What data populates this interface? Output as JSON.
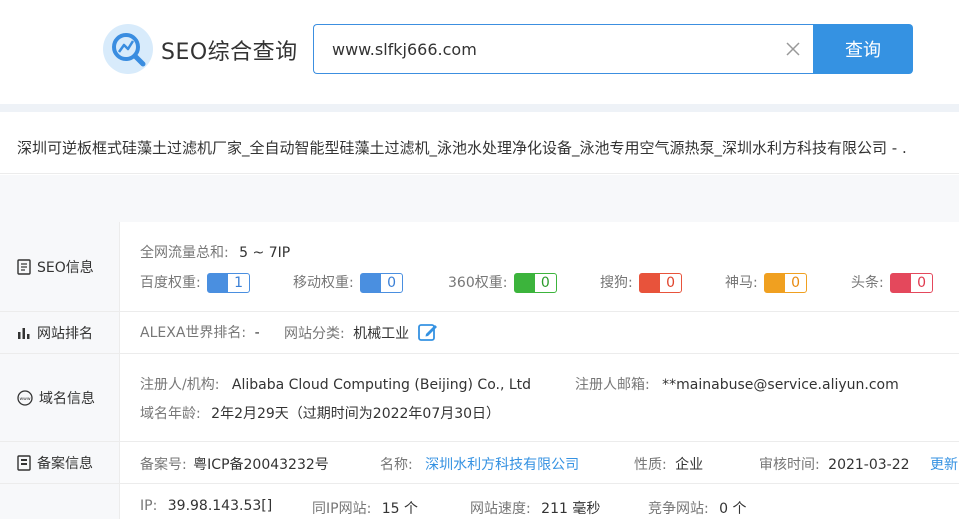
{
  "header": {
    "brand": "SEO综合查询",
    "search_value": "www.slfkj666.com",
    "search_button": "查询"
  },
  "title": "深圳可逆板框式硅藻土过滤机厂家_全自动智能型硅藻土过滤机_泳池水处理净化设备_泳池专用空气源热泵_深圳水利方科技有限公司 - .",
  "seo": {
    "label": "SEO信息",
    "traffic_label": "全网流量总和:",
    "traffic_value": "5 ~ 7IP",
    "weights": [
      {
        "label": "百度权重:",
        "value": "1",
        "icon": "baidu-paw-icon",
        "color": "#4a8fe0"
      },
      {
        "label": "移动权重:",
        "value": "0",
        "icon": "mobile-paw-icon",
        "color": "#4a8fe0"
      },
      {
        "label": "360权重:",
        "value": "0",
        "icon": "360-logo-icon",
        "color": "#3cb43c"
      },
      {
        "label": "搜狗:",
        "value": "0",
        "icon": "sogou-logo-icon",
        "color": "#e8533b"
      },
      {
        "label": "神马:",
        "value": "0",
        "icon": "shenma-logo-icon",
        "color": "#f0a020"
      },
      {
        "label": "头条:",
        "value": "0",
        "icon": "toutiao-logo-icon",
        "color": "#e4485c"
      }
    ]
  },
  "rank": {
    "label": "网站排名",
    "alexa_label": "ALEXA世界排名:",
    "alexa_value": "-",
    "category_label": "网站分类:",
    "category_value": "机械工业"
  },
  "domain": {
    "label": "域名信息",
    "registrant_label": "注册人/机构:",
    "registrant_value": "Alibaba Cloud Computing (Beijing) Co., Ltd",
    "email_label": "注册人邮箱:",
    "email_value": "**mainabuse@service.aliyun.com",
    "age_label": "域名年龄:",
    "age_value": "2年2月29天（过期时间为2022年07月30日）"
  },
  "icp": {
    "label": "备案信息",
    "number_label": "备案号:",
    "number_value": "粤ICP备20043232号",
    "name_label": "名称:",
    "name_value": "深圳水利方科技有限公司",
    "nature_label": "性质:",
    "nature_value": "企业",
    "review_label": "审核时间:",
    "review_value": "2021-03-22",
    "update_link": "更新"
  },
  "server": {
    "ip_label": "IP:",
    "ip_value": "39.98.143.53[]",
    "same_ip_label": "同IP网站:",
    "same_ip_value": "15 个",
    "speed_label": "网站速度:",
    "speed_value": "211 毫秒",
    "compete_label": "竞争网站:",
    "compete_value": "0 个"
  },
  "colors": {
    "accent": "#3592e2",
    "border": "#ececec",
    "label_bg": "#f7f8fa"
  }
}
